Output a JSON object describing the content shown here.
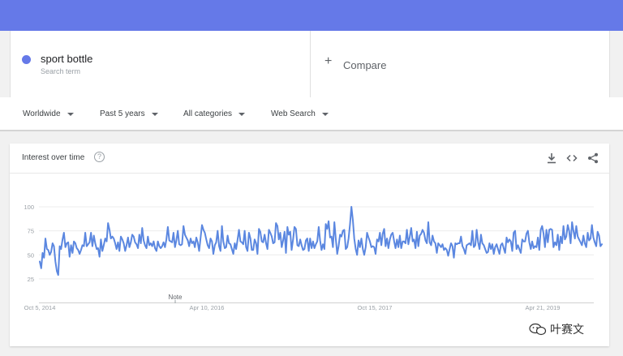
{
  "search_term": {
    "name": "sport bottle",
    "sub": "Search term",
    "color": "#6579e8"
  },
  "compare": {
    "label": "Compare"
  },
  "filters": {
    "region": "Worldwide",
    "period": "Past 5 years",
    "category": "All categories",
    "source": "Web Search"
  },
  "card": {
    "title": "Interest over time",
    "help_glyph": "?"
  },
  "watermark": {
    "text": "叶赛文"
  },
  "chart_data": {
    "type": "line",
    "title": "Interest over time",
    "series": [
      {
        "name": "sport bottle",
        "color": "#5b87e0",
        "values": [
          43,
          36,
          52,
          47,
          67,
          56,
          55,
          50,
          53,
          62,
          59,
          43,
          33,
          29,
          59,
          56,
          66,
          73,
          58,
          62,
          63,
          48,
          60,
          52,
          64,
          62,
          57,
          55,
          51,
          55,
          60,
          59,
          73,
          59,
          61,
          63,
          73,
          59,
          70,
          62,
          56,
          57,
          48,
          66,
          54,
          60,
          67,
          64,
          83,
          76,
          67,
          69,
          67,
          62,
          56,
          63,
          54,
          69,
          66,
          62,
          54,
          60,
          68,
          58,
          63,
          71,
          69,
          63,
          61,
          57,
          71,
          62,
          78,
          65,
          60,
          57,
          69,
          60,
          62,
          59,
          64,
          57,
          54,
          64,
          59,
          57,
          59,
          63,
          58,
          66,
          79,
          65,
          64,
          63,
          73,
          58,
          65,
          75,
          61,
          60,
          61,
          80,
          71,
          68,
          65,
          59,
          67,
          62,
          64,
          58,
          68,
          63,
          54,
          68,
          81,
          76,
          73,
          66,
          60,
          57,
          67,
          64,
          51,
          60,
          63,
          75,
          59,
          54,
          80,
          64,
          57,
          58,
          70,
          62,
          61,
          56,
          51,
          62,
          56,
          66,
          76,
          64,
          63,
          61,
          75,
          58,
          54,
          73,
          67,
          55,
          55,
          66,
          62,
          51,
          77,
          74,
          64,
          63,
          71,
          62,
          56,
          76,
          73,
          69,
          62,
          63,
          83,
          80,
          66,
          73,
          58,
          65,
          74,
          52,
          79,
          71,
          74,
          55,
          66,
          79,
          77,
          60,
          59,
          66,
          60,
          55,
          56,
          65,
          67,
          54,
          67,
          57,
          64,
          57,
          61,
          64,
          79,
          65,
          55,
          61,
          56,
          82,
          77,
          85,
          68,
          69,
          58,
          84,
          67,
          51,
          59,
          71,
          69,
          75,
          76,
          56,
          58,
          67,
          82,
          100,
          86,
          67,
          56,
          50,
          65,
          58,
          67,
          56,
          50,
          58,
          73,
          68,
          64,
          58,
          59,
          58,
          51,
          66,
          64,
          73,
          60,
          72,
          77,
          59,
          67,
          57,
          66,
          71,
          73,
          64,
          57,
          66,
          58,
          70,
          57,
          64,
          64,
          62,
          76,
          61,
          69,
          78,
          64,
          66,
          57,
          74,
          59,
          70,
          72,
          76,
          73,
          65,
          62,
          84,
          63,
          60,
          70,
          64,
          62,
          52,
          62,
          60,
          58,
          61,
          55,
          57,
          55,
          49,
          56,
          62,
          59,
          47,
          62,
          61,
          62,
          62,
          69,
          59,
          56,
          51,
          60,
          61,
          62,
          60,
          75,
          58,
          60,
          76,
          63,
          56,
          71,
          62,
          60,
          56,
          52,
          53,
          62,
          56,
          61,
          51,
          58,
          61,
          56,
          51,
          60,
          62,
          57,
          52,
          68,
          63,
          66,
          64,
          54,
          73,
          75,
          56,
          60,
          56,
          52,
          66,
          64,
          64,
          72,
          75,
          63,
          56,
          64,
          57,
          59,
          58,
          68,
          55,
          76,
          80,
          72,
          58,
          76,
          63,
          76,
          77,
          76,
          58,
          63,
          60,
          71,
          55,
          69,
          62,
          80,
          66,
          69,
          81,
          75,
          62,
          84,
          75,
          67,
          80,
          69,
          66,
          63,
          60,
          70,
          62,
          58,
          73,
          65,
          67,
          81,
          68,
          63,
          59,
          74,
          70,
          59,
          61
        ]
      }
    ],
    "x_tick_labels": [
      "Oct 5, 2014",
      "Apr 10, 2016",
      "Oct 15, 2017",
      "Apr 21, 2019"
    ],
    "y_tick_labels": [
      "100",
      "75",
      "50",
      "25"
    ],
    "ylim": [
      0,
      100
    ],
    "annotation": "Note",
    "grid": true
  }
}
